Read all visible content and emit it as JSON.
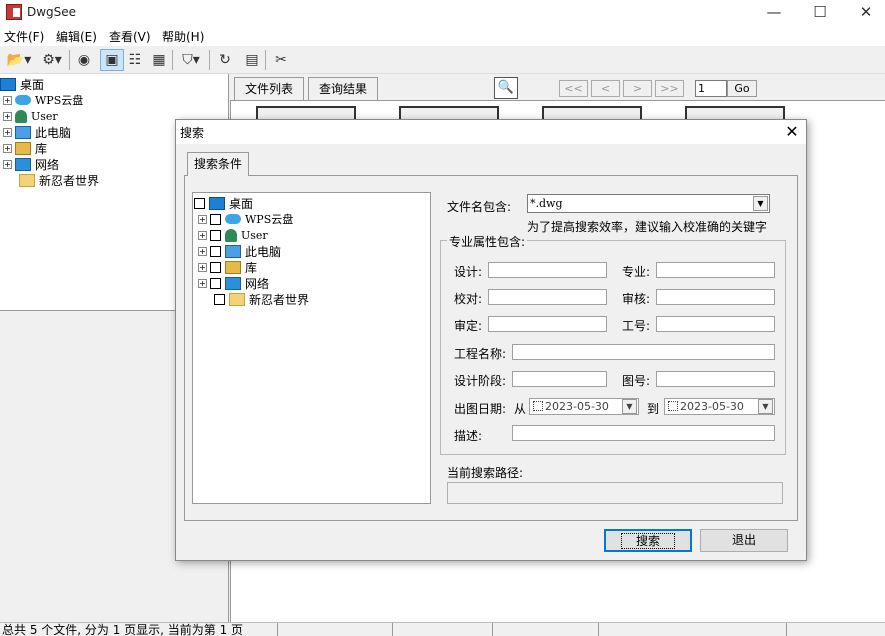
{
  "window": {
    "title": "DwgSee",
    "min": "—",
    "max": "☐",
    "close": "✕"
  },
  "menu": [
    "文件(F)",
    "编辑(E)",
    "查看(V)",
    "帮助(H)"
  ],
  "toolbar": {
    "icons": [
      "open-dropdown-icon",
      "print-dropdown-icon",
      "view-icon",
      "thumbnail-view-icon",
      "list-view-icon",
      "detail-view-icon",
      "filter-dropdown-icon",
      "refresh-icon",
      "properties-icon",
      "tools-icon"
    ]
  },
  "left_tree": {
    "root": "桌面",
    "items": [
      "WPS云盘",
      "User",
      "此电脑",
      "库",
      "网络",
      "新忍者世界"
    ]
  },
  "right_tabs": [
    "文件列表",
    "查询结果"
  ],
  "pager": {
    "first": "<<",
    "prev": "<",
    "next": ">",
    "last": ">>",
    "page": "1",
    "go": "Go"
  },
  "status": {
    "text": "总共 5 个文件, 分为 1 页显示, 当前为第 1 页"
  },
  "dialog": {
    "title": "搜索",
    "close": "✕",
    "tab": "搜索条件",
    "tree": {
      "root": "桌面",
      "items": [
        "WPS云盘",
        "User",
        "此电脑",
        "库",
        "网络",
        "新忍者世界"
      ]
    },
    "filename_label": "文件名包含:",
    "filename_value": "*.dwg",
    "hint": "为了提高搜索效率，建议输入校准确的关键字",
    "attr_legend": "专业属性包含:",
    "fields": {
      "design": "设计:",
      "major": "专业:",
      "proof": "校对:",
      "review": "审核:",
      "approve": "审定:",
      "job_no": "工号:",
      "project": "工程名称:",
      "stage": "设计阶段:",
      "drawing_no": "图号:",
      "date": "出图日期:",
      "from": "从",
      "to": "到",
      "desc": "描述:"
    },
    "date_from": "2023-05-30",
    "date_to": "2023-05-30",
    "path_label": "当前搜索路径:",
    "search_button": "搜索",
    "exit_button": "退出"
  }
}
